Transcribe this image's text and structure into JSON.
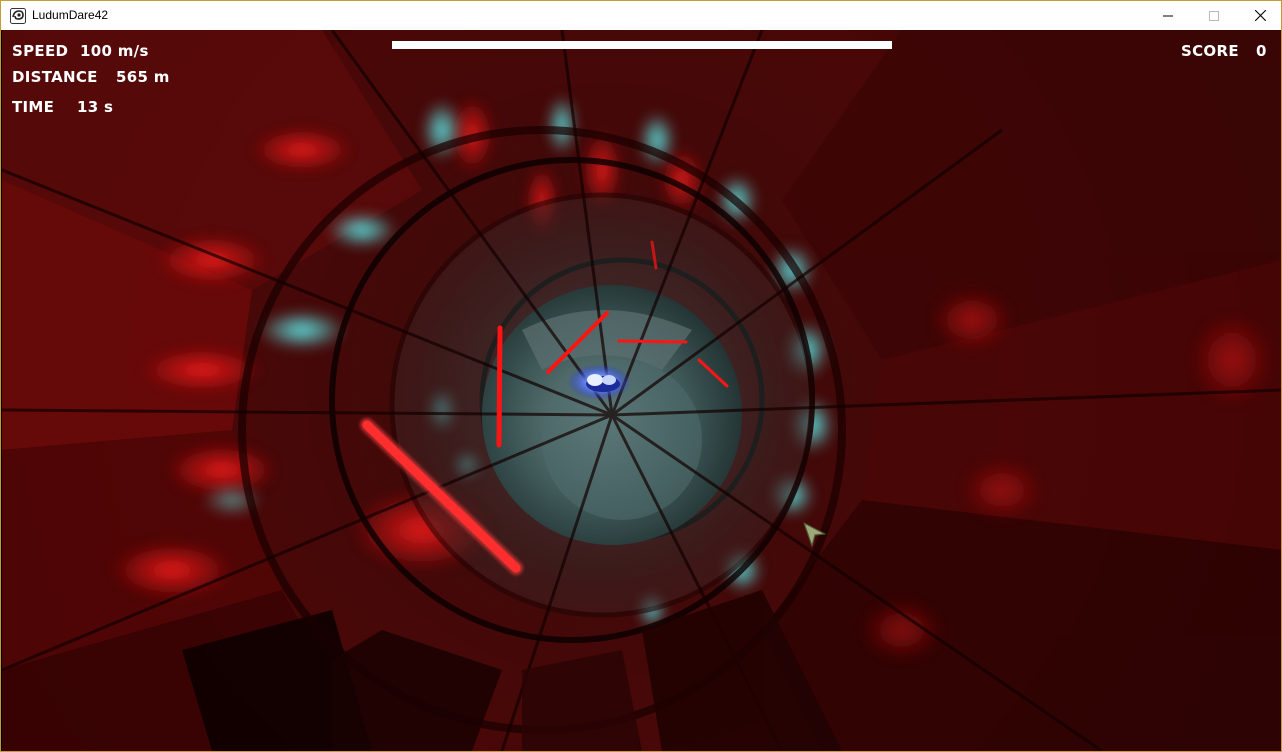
{
  "window": {
    "title": "LudumDare42",
    "icon": "app-icon",
    "border_color": "#c99a2e"
  },
  "hud": {
    "speed_label": "SPEED",
    "speed_value": "100 m/s",
    "distance_label": "DISTANCE",
    "distance_value": "565 m",
    "time_label": "TIME",
    "time_value": "13 s",
    "score_label": "SCORE",
    "score_value": "0",
    "progress_fraction": 1.0
  },
  "scene": {
    "tunnel_red": "#e0121a",
    "tunnel_cyan": "#3fd6d6",
    "tunnel_dark": "#1a0000",
    "ship_color": "#4a7bff"
  },
  "cursor": {
    "icon": "arrow-cursor-icon"
  }
}
